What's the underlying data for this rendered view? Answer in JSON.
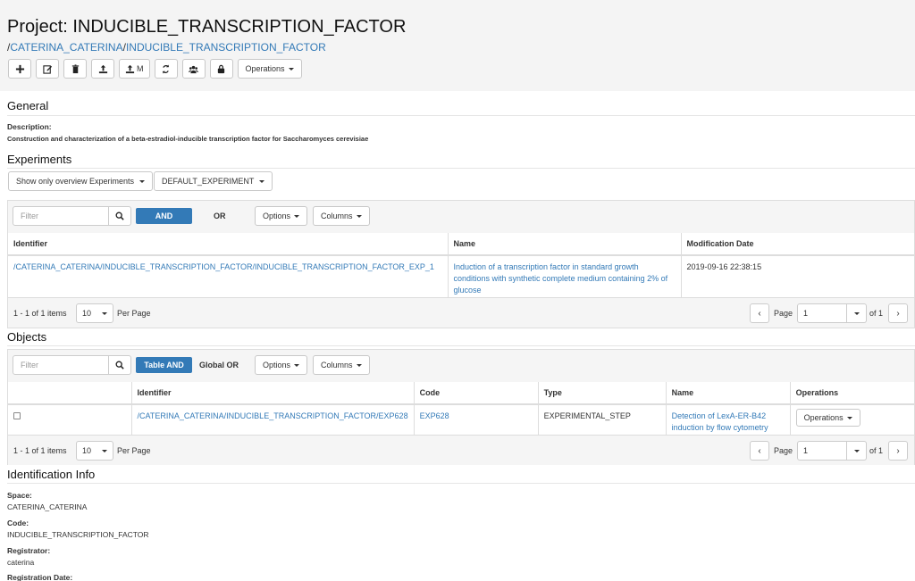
{
  "header": {
    "title": "Project: INDUCIBLE_TRANSCRIPTION_FACTOR",
    "crumb_sep": "/",
    "crumb_space": "CATERINA_CATERINA",
    "crumb_project": "INDUCIBLE_TRANSCRIPTION_FACTOR",
    "toolbar": {
      "icons": [
        "plus-icon",
        "edit-icon",
        "trash-icon",
        "upload-icon",
        "upload-multiple-icon",
        "refresh-icon",
        "users-icon",
        "lock-icon"
      ],
      "upload_multiple_label": "M",
      "operations_label": "Operations"
    }
  },
  "general": {
    "heading": "General",
    "description_label": "Description:",
    "description_value": "Construction and characterization of a beta-estradiol-inducible transcription factor for Saccharomyces cerevisiae"
  },
  "experiments": {
    "heading": "Experiments",
    "show_filter": "Show only overview Experiments",
    "experiment_filter": "DEFAULT_EXPERIMENT",
    "grid": {
      "filter_placeholder": "Filter",
      "and_label": "AND",
      "or_label": "OR",
      "options_label": "Options",
      "columns_label": "Columns",
      "headers": [
        "Identifier",
        "Name",
        "Modification Date"
      ],
      "rows": [
        {
          "identifier": "/CATERINA_CATERINA/INDUCIBLE_TRANSCRIPTION_FACTOR/INDUCIBLE_TRANSCRIPTION_FACTOR_EXP_1",
          "name": "Induction of a transcription factor in standard growth conditions with synthetic complete medium containing 2% of glucose",
          "modification_date": "2019-09-16 22:38:15"
        }
      ],
      "pager": {
        "count_text": "1 - 1 of 1 items",
        "per_page_value": "10",
        "per_page_label": "Per Page",
        "page_label": "Page",
        "page_value": "1",
        "of_text": "of 1",
        "prev": "‹",
        "next": "›"
      }
    }
  },
  "objects": {
    "heading": "Objects",
    "grid": {
      "filter_placeholder": "Filter",
      "and_label": "Table AND",
      "or_label": "Global OR",
      "options_label": "Options",
      "columns_label": "Columns",
      "headers": [
        "",
        "Identifier",
        "Code",
        "Type",
        "Name",
        "Operations"
      ],
      "rows": [
        {
          "identifier": "/CATERINA_CATERINA/INDUCIBLE_TRANSCRIPTION_FACTOR/EXP628",
          "code": "EXP628",
          "type": "EXPERIMENTAL_STEP",
          "name": "Detection of LexA-ER-B42 induction by flow cytometry",
          "operations_label": "Operations"
        }
      ],
      "pager": {
        "count_text": "1 - 1 of 1 items",
        "per_page_value": "10",
        "per_page_label": "Per Page",
        "page_label": "Page",
        "page_value": "1",
        "of_text": "of 1",
        "prev": "‹",
        "next": "›"
      }
    }
  },
  "identification": {
    "heading": "Identification Info",
    "space_label": "Space:",
    "space_value": "CATERINA_CATERINA",
    "code_label": "Code:",
    "code_value": "INDUCIBLE_TRANSCRIPTION_FACTOR",
    "registrator_label": "Registrator:",
    "registrator_value": "caterina",
    "registration_date_label": "Registration Date:"
  },
  "colors": {
    "link": "#337ab7",
    "primary_button": "#337ab7",
    "header_bg": "#f4f4f4",
    "toolbar_bg": "#f5f5f5"
  }
}
